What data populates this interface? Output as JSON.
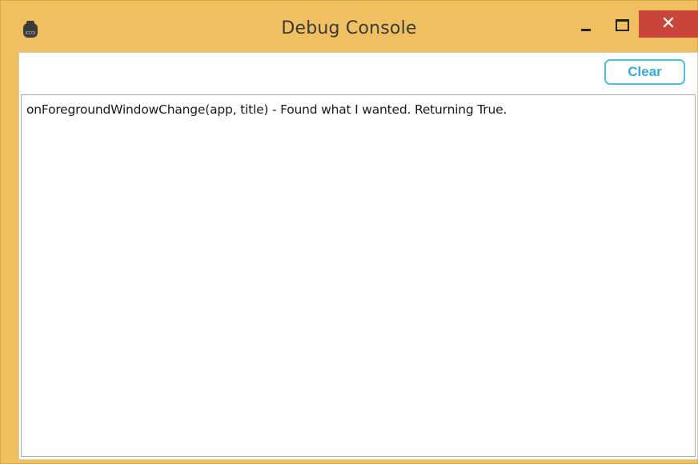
{
  "window": {
    "title": "Debug Console",
    "icon": "robot-icon",
    "controls": {
      "minimize_icon": "minimize-icon",
      "maximize_icon": "maximize-icon",
      "close_glyph": "✕"
    },
    "colors": {
      "frame": "#f0c060",
      "close_button": "#c9443a",
      "clear_button_accent": "#4dbfdf"
    }
  },
  "toolbar": {
    "clear_label": "Clear"
  },
  "log": {
    "lines": [
      "onForegroundWindowChange(app, title) - Found what I wanted. Returning True."
    ]
  }
}
